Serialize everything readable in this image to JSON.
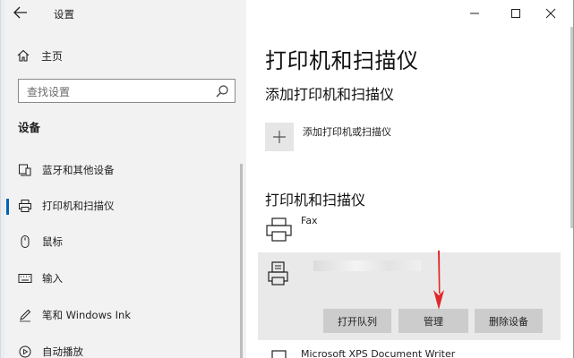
{
  "window": {
    "title": "设置"
  },
  "sidebar": {
    "home_label": "主页",
    "search_placeholder": "查找设置",
    "section_title": "设备",
    "items": [
      {
        "label": "蓝牙和其他设备",
        "icon": "bluetooth-devices-icon",
        "selected": false
      },
      {
        "label": "打印机和扫描仪",
        "icon": "printer-icon",
        "selected": true
      },
      {
        "label": "鼠标",
        "icon": "mouse-icon",
        "selected": false
      },
      {
        "label": "输入",
        "icon": "keyboard-icon",
        "selected": false
      },
      {
        "label": "笔和 Windows Ink",
        "icon": "pen-icon",
        "selected": false
      },
      {
        "label": "自动播放",
        "icon": "autoplay-icon",
        "selected": false
      }
    ]
  },
  "main": {
    "page_title": "打印机和扫描仪",
    "add_section_title": "添加打印机和扫描仪",
    "add_button_label": "添加打印机或扫描仪",
    "list_section_title": "打印机和扫描仪",
    "printers": [
      {
        "name": "Fax",
        "icon": "fax-printer-icon"
      },
      {
        "name": "",
        "icon": "printer-doc-icon",
        "selected": true
      },
      {
        "name": "Microsoft XPS Document Writer",
        "icon": "printer-icon"
      }
    ],
    "card_buttons": {
      "open_queue": "打开队列",
      "manage": "管理",
      "remove": "删除设备"
    }
  },
  "colors": {
    "accent": "#0063b1",
    "annotation_arrow": "#e0292b",
    "sidebar_bg": "#f2f2f2",
    "button_bg": "#cccccc"
  }
}
